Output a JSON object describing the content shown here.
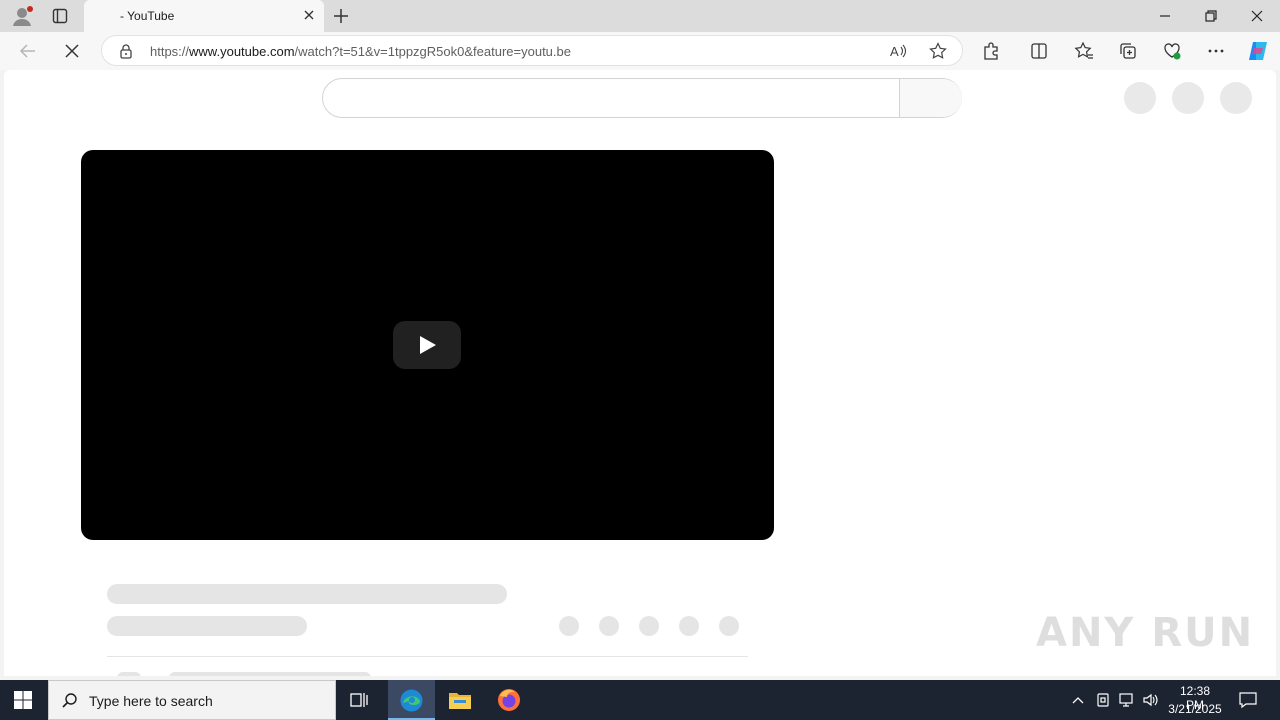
{
  "browser": {
    "tab": {
      "title": "- YouTube"
    },
    "address": {
      "prefix": "https://",
      "host": "www.youtube.com",
      "path": "/watch?t=51&v=1tppzgR5ok0&feature=youtu.be"
    }
  },
  "watermark": {
    "text": "ANY RUN"
  },
  "taskbar": {
    "search_placeholder": "Type here to search",
    "clock": {
      "time": "12:38 PM",
      "date": "3/21/2025"
    }
  },
  "colors": {
    "player_bg": "#000000",
    "taskbar_bg": "#1c2331",
    "skeleton": "#e5e5e5"
  }
}
